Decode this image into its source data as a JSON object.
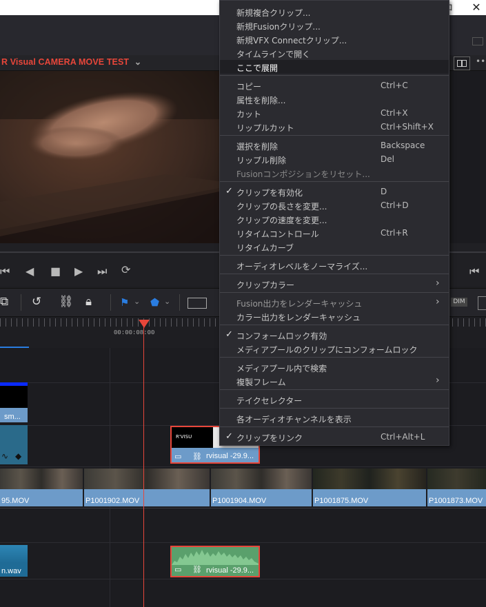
{
  "window": {
    "close_glyph": "✕",
    "top_char": "ロ"
  },
  "timeline": {
    "title": "R Visual CAMERA MOVE TEST",
    "chevron": "⌄"
  },
  "ruler": {
    "timecode": "00:00:08:00"
  },
  "toolbar": {
    "dim_label": "DIM"
  },
  "clips": {
    "v2_left": "sm...",
    "v2_red": "rvisual -29.9...",
    "v1": [
      "95.MOV",
      "P1001902.MOV",
      "P1001904.MOV",
      "P1001875.MOV",
      "P1001873.MOV"
    ],
    "a1_left": "n.wav",
    "a1_red": "rvisual -29.9..."
  },
  "menu": {
    "items": [
      {
        "label": "新規複合クリップ..."
      },
      {
        "label": "新規Fusionクリップ..."
      },
      {
        "label": "新規VFX Connectクリップ..."
      },
      {
        "label": "タイムラインで開く"
      },
      {
        "label": "ここで展開"
      },
      {
        "label": "コピー",
        "shortcut": "Ctrl+C"
      },
      {
        "label": "属性を削除..."
      },
      {
        "label": "カット",
        "shortcut": "Ctrl+X"
      },
      {
        "label": "リップルカット",
        "shortcut": "Ctrl+Shift+X"
      },
      {
        "label": "選択を削除",
        "shortcut": "Backspace"
      },
      {
        "label": "リップル削除",
        "shortcut": "Del"
      },
      {
        "label": "Fusionコンポジションをリセット..."
      },
      {
        "label": "クリップを有効化",
        "shortcut": "D"
      },
      {
        "label": "クリップの長さを変更...",
        "shortcut": "Ctrl+D"
      },
      {
        "label": "クリップの速度を変更..."
      },
      {
        "label": "リタイムコントロール",
        "shortcut": "Ctrl+R"
      },
      {
        "label": "リタイムカーブ"
      },
      {
        "label": "オーディオレベルをノーマライズ..."
      },
      {
        "label": "クリップカラー"
      },
      {
        "label": "Fusion出力をレンダーキャッシュ"
      },
      {
        "label": "カラー出力をレンダーキャッシュ"
      },
      {
        "label": "コンフォームロック有効"
      },
      {
        "label": "メディアプールのクリップにコンフォームロック"
      },
      {
        "label": "メディアプール内で検索"
      },
      {
        "label": "複製フレーム"
      },
      {
        "label": "テイクセレクター"
      },
      {
        "label": "各オーディオチャンネルを表示"
      },
      {
        "label": "クリップをリンク",
        "shortcut": "Ctrl+Alt+L"
      }
    ],
    "check_glyph": "✓",
    "arrow_glyph": "›"
  },
  "colors": {
    "accent_red": "#e8463a",
    "clip_blue": "#6d9bc9",
    "audio_green": "#5aa06c"
  },
  "icons": [
    "prev-clip-icon",
    "step-back-icon",
    "stop-icon",
    "play-icon",
    "next-clip-icon",
    "loop-icon",
    "end-icon",
    "snap-icon",
    "link-icon",
    "lock-icon",
    "flag-icon",
    "marker-icon",
    "zoom-icon"
  ]
}
